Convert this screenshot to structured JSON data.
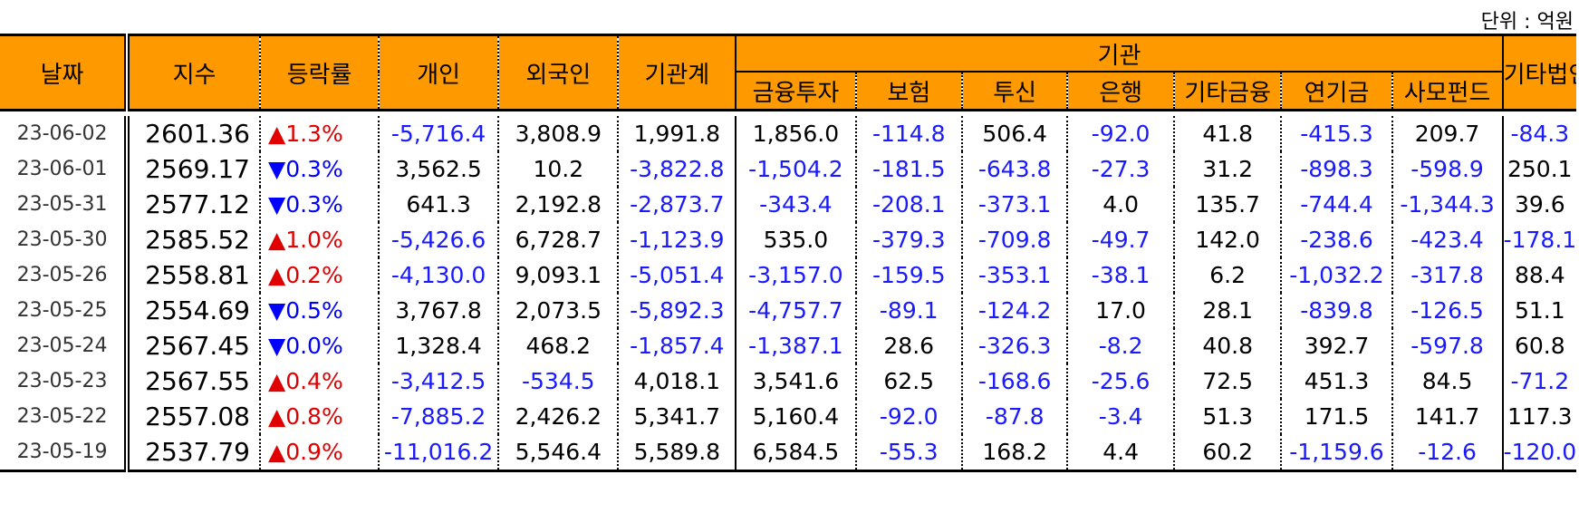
{
  "unit_label": "단위 : 억원",
  "header": {
    "date": "날짜",
    "index": "지수",
    "change": "등락률",
    "individual": "개인",
    "foreign": "외국인",
    "inst_total": "기관계",
    "institution_group": "기관",
    "financial_invest": "금융투자",
    "insurance": "보험",
    "trust": "투신",
    "bank": "은행",
    "other_finance": "기타금융",
    "pension": "연기금",
    "private_fund": "사모펀드",
    "other_corp": "기타법인"
  },
  "rows": [
    {
      "date": "23-06-02",
      "index": "2601.36",
      "arrow": "▲",
      "change": "1.3%",
      "dir": "up",
      "individual": "-5,716.4",
      "foreign": "3,808.9",
      "inst_total": "1,991.8",
      "financial_invest": "1,856.0",
      "insurance": "-114.8",
      "trust": "506.4",
      "bank": "-92.0",
      "other_finance": "41.8",
      "pension": "-415.3",
      "private_fund": "209.7",
      "other_corp": "-84.3"
    },
    {
      "date": "23-06-01",
      "index": "2569.17",
      "arrow": "▼",
      "change": "0.3%",
      "dir": "dn",
      "individual": "3,562.5",
      "foreign": "10.2",
      "inst_total": "-3,822.8",
      "financial_invest": "-1,504.2",
      "insurance": "-181.5",
      "trust": "-643.8",
      "bank": "-27.3",
      "other_finance": "31.2",
      "pension": "-898.3",
      "private_fund": "-598.9",
      "other_corp": "250.1"
    },
    {
      "date": "23-05-31",
      "index": "2577.12",
      "arrow": "▼",
      "change": "0.3%",
      "dir": "dn",
      "individual": "641.3",
      "foreign": "2,192.8",
      "inst_total": "-2,873.7",
      "financial_invest": "-343.4",
      "insurance": "-208.1",
      "trust": "-373.1",
      "bank": "4.0",
      "other_finance": "135.7",
      "pension": "-744.4",
      "private_fund": "-1,344.3",
      "other_corp": "39.6"
    },
    {
      "date": "23-05-30",
      "index": "2585.52",
      "arrow": "▲",
      "change": "1.0%",
      "dir": "up",
      "individual": "-5,426.6",
      "foreign": "6,728.7",
      "inst_total": "-1,123.9",
      "financial_invest": "535.0",
      "insurance": "-379.3",
      "trust": "-709.8",
      "bank": "-49.7",
      "other_finance": "142.0",
      "pension": "-238.6",
      "private_fund": "-423.4",
      "other_corp": "-178.1"
    },
    {
      "date": "23-05-26",
      "index": "2558.81",
      "arrow": "▲",
      "change": "0.2%",
      "dir": "up",
      "individual": "-4,130.0",
      "foreign": "9,093.1",
      "inst_total": "-5,051.4",
      "financial_invest": "-3,157.0",
      "insurance": "-159.5",
      "trust": "-353.1",
      "bank": "-38.1",
      "other_finance": "6.2",
      "pension": "-1,032.2",
      "private_fund": "-317.8",
      "other_corp": "88.4"
    },
    {
      "date": "23-05-25",
      "index": "2554.69",
      "arrow": "▼",
      "change": "0.5%",
      "dir": "dn",
      "individual": "3,767.8",
      "foreign": "2,073.5",
      "inst_total": "-5,892.3",
      "financial_invest": "-4,757.7",
      "insurance": "-89.1",
      "trust": "-124.2",
      "bank": "17.0",
      "other_finance": "28.1",
      "pension": "-839.8",
      "private_fund": "-126.5",
      "other_corp": "51.1"
    },
    {
      "date": "23-05-24",
      "index": "2567.45",
      "arrow": "▼",
      "change": "0.0%",
      "dir": "dn",
      "individual": "1,328.4",
      "foreign": "468.2",
      "inst_total": "-1,857.4",
      "financial_invest": "-1,387.1",
      "insurance": "28.6",
      "trust": "-326.3",
      "bank": "-8.2",
      "other_finance": "40.8",
      "pension": "392.7",
      "private_fund": "-597.8",
      "other_corp": "60.8"
    },
    {
      "date": "23-05-23",
      "index": "2567.55",
      "arrow": "▲",
      "change": "0.4%",
      "dir": "up",
      "individual": "-3,412.5",
      "foreign": "-534.5",
      "inst_total": "4,018.1",
      "financial_invest": "3,541.6",
      "insurance": "62.5",
      "trust": "-168.6",
      "bank": "-25.6",
      "other_finance": "72.5",
      "pension": "451.3",
      "private_fund": "84.5",
      "other_corp": "-71.2"
    },
    {
      "date": "23-05-22",
      "index": "2557.08",
      "arrow": "▲",
      "change": "0.8%",
      "dir": "up",
      "individual": "-7,885.2",
      "foreign": "2,426.2",
      "inst_total": "5,341.7",
      "financial_invest": "5,160.4",
      "insurance": "-92.0",
      "trust": "-87.8",
      "bank": "-3.4",
      "other_finance": "51.3",
      "pension": "171.5",
      "private_fund": "141.7",
      "other_corp": "117.3"
    },
    {
      "date": "23-05-19",
      "index": "2537.79",
      "arrow": "▲",
      "change": "0.9%",
      "dir": "up",
      "individual": "-11,016.2",
      "foreign": "5,546.4",
      "inst_total": "5,589.8",
      "financial_invest": "6,584.5",
      "insurance": "-55.3",
      "trust": "168.2",
      "bank": "4.4",
      "other_finance": "60.2",
      "pension": "-1,159.6",
      "private_fund": "-12.6",
      "other_corp": "-120.0"
    }
  ]
}
